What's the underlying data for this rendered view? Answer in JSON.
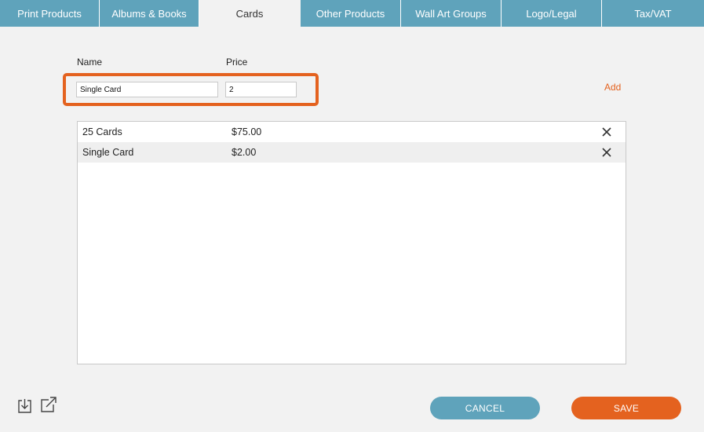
{
  "tabs": [
    {
      "label": "Print Products"
    },
    {
      "label": "Albums & Books"
    },
    {
      "label": "Cards"
    },
    {
      "label": "Other Products"
    },
    {
      "label": "Wall Art Groups"
    },
    {
      "label": "Logo/Legal"
    },
    {
      "label": "Tax/VAT"
    }
  ],
  "active_tab": "Cards",
  "form": {
    "name_label": "Name",
    "price_label": "Price",
    "name_value": "Single Card",
    "price_value": "2",
    "add_label": "Add"
  },
  "items": [
    {
      "name": "25 Cards",
      "price": "$75.00"
    },
    {
      "name": "Single Card",
      "price": "$2.00"
    }
  ],
  "footer": {
    "cancel_label": "CANCEL",
    "save_label": "SAVE",
    "import_icon": "import-icon",
    "export_icon": "export-icon"
  },
  "colors": {
    "accent_orange": "#e4621f",
    "tab_blue": "#5fa3bb",
    "background": "#f2f2f2"
  }
}
